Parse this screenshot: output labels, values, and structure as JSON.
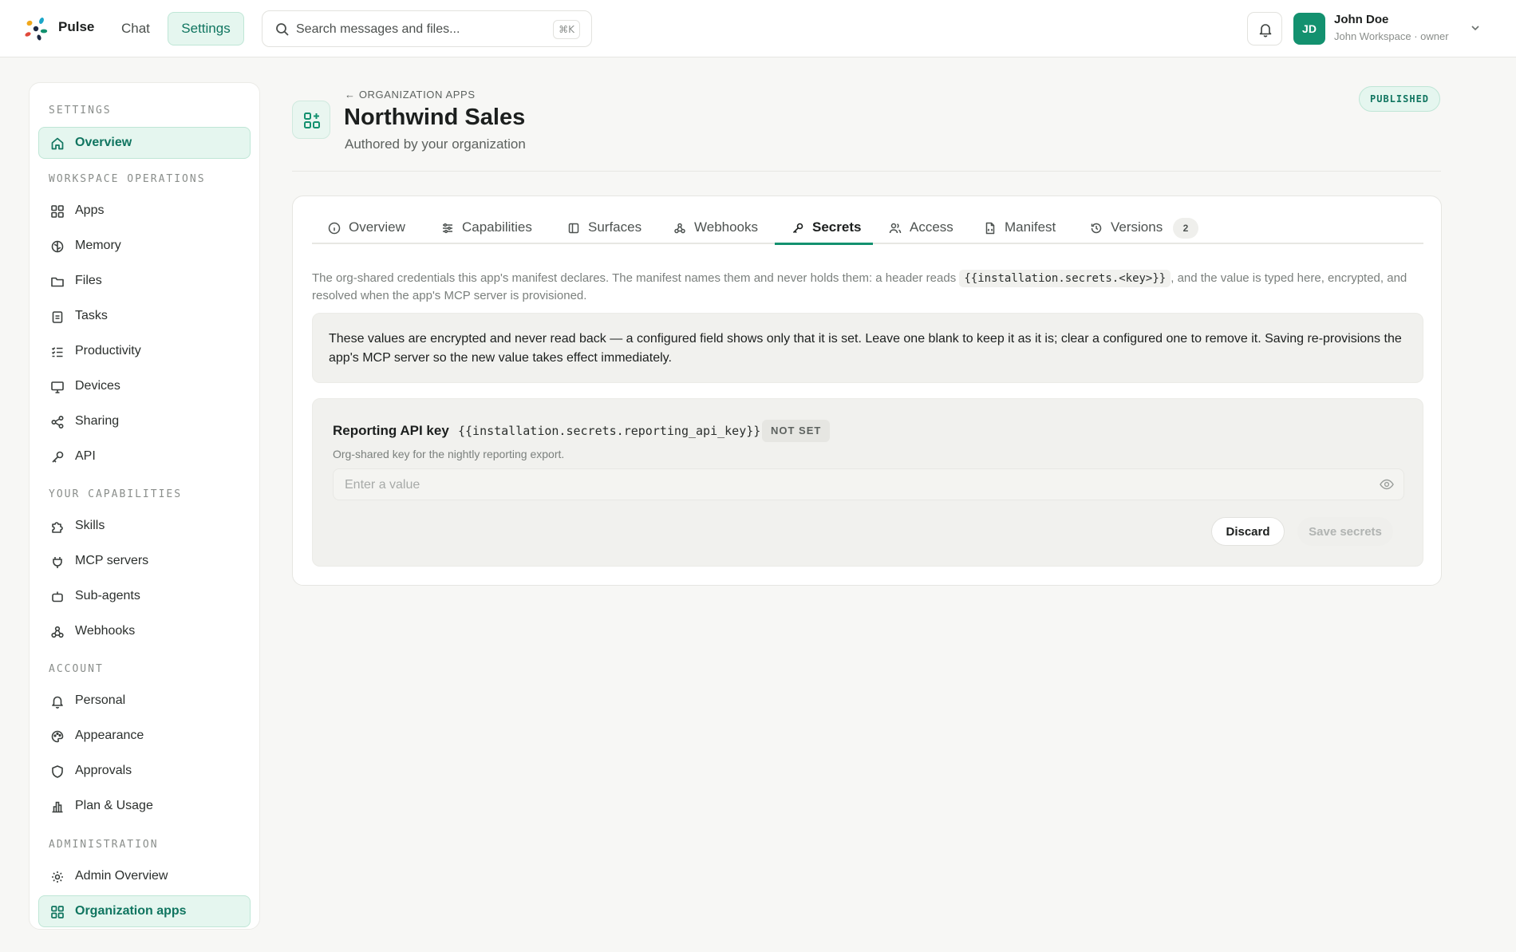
{
  "topbar": {
    "brand": "Pulse",
    "nav": {
      "chat": "Chat",
      "settings": "Settings"
    },
    "search": {
      "placeholder": "Search messages and files...",
      "shortcut": "⌘K"
    },
    "user": {
      "initials": "JD",
      "name": "John Doe",
      "subtitle": "John Workspace · owner"
    }
  },
  "sidebar": {
    "sections": {
      "settings": "SETTINGS",
      "workspace": "WORKSPACE OPERATIONS",
      "capabilities": "YOUR CAPABILITIES",
      "account": "ACCOUNT",
      "administration": "ADMINISTRATION"
    },
    "items": {
      "overview": "Overview",
      "apps": "Apps",
      "memory": "Memory",
      "files": "Files",
      "tasks": "Tasks",
      "productivity": "Productivity",
      "devices": "Devices",
      "sharing": "Sharing",
      "api": "API",
      "skills": "Skills",
      "mcp_servers": "MCP servers",
      "sub_agents": "Sub-agents",
      "webhooks": "Webhooks",
      "personal": "Personal",
      "appearance": "Appearance",
      "approvals": "Approvals",
      "plan_usage": "Plan & Usage",
      "admin_overview": "Admin Overview",
      "organization_apps": "Organization apps"
    },
    "active": [
      "Overview",
      "Organization apps"
    ]
  },
  "header": {
    "breadcrumb": "ORGANIZATION APPS",
    "title": "Northwind Sales",
    "subtitle": "Authored by your organization",
    "status": "PUBLISHED"
  },
  "tabs": {
    "overview": "Overview",
    "capabilities": "Capabilities",
    "surfaces": "Surfaces",
    "webhooks": "Webhooks",
    "secrets": "Secrets",
    "access": "Access",
    "manifest": "Manifest",
    "versions": "Versions",
    "versions_count": "2",
    "active": "Secrets"
  },
  "secrets": {
    "intro_before": "The org-shared credentials this app's manifest declares. The manifest names them and never holds them: a header reads",
    "intro_code": "{{installation.secrets.<key>}}",
    "intro_after": ", and the value is typed here, encrypted, and resolved when the app's MCP server is provisioned.",
    "notice": "These values are encrypted and never read back — a configured field shows only that it is set. Leave one blank to keep it as it is; clear a configured one to remove it. Saving re-provisions the app's MCP server so the new value takes effect immediately.",
    "item": {
      "name": "Reporting API key",
      "key": "{{installation.secrets.reporting_api_key}}",
      "state": "NOT SET",
      "description": "Org-shared key for the nightly reporting export.",
      "value": "",
      "placeholder": "Enter a value"
    },
    "actions": {
      "discard": "Discard",
      "save": "Save secrets"
    }
  },
  "colors": {
    "accent": "#13916f",
    "accent_soft": "#e5f6ef",
    "page_bg": "#f7f7f5"
  },
  "icons": {
    "logo": "pulse-logo",
    "search": "search-icon",
    "bell": "bell-icon",
    "user_menu": "chevron-down-icon",
    "visibility": "eye-icon"
  }
}
